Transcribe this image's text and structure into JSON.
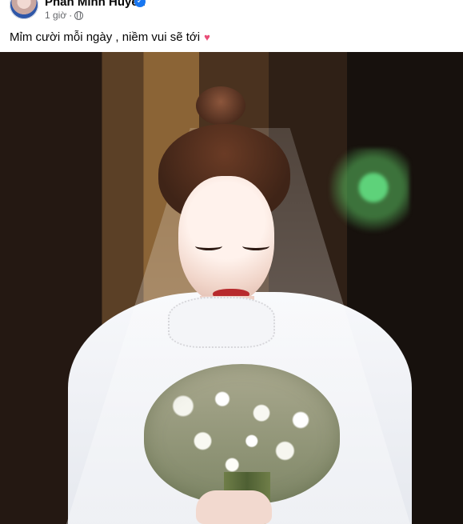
{
  "post": {
    "author": "Phan Minh Huyền",
    "time": "1 giờ",
    "privacy_icon": "globe-icon",
    "verified_icon": "verified-badge-icon",
    "caption": "Mỉm cười mỗi ngày , niềm vui sẽ tới",
    "caption_emoji_icon": "heart-icon"
  },
  "colors": {
    "primary_text": "#050505",
    "secondary_text": "#65676b",
    "verified_blue": "#1877f2",
    "heart_pink": "#e94d77"
  }
}
